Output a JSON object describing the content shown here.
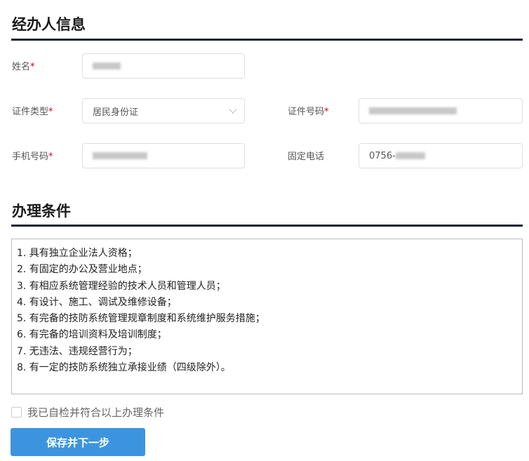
{
  "section1": {
    "title": "经办人信息"
  },
  "fields": {
    "name": {
      "label": "姓名",
      "required": "*"
    },
    "id_type": {
      "label": "证件类型",
      "required": "*",
      "value": "居民身份证"
    },
    "id_number": {
      "label": "证件号码",
      "required": "*"
    },
    "mobile": {
      "label": "手机号码",
      "required": "*"
    },
    "landline": {
      "label": "固定电话",
      "value_prefix": "0756-"
    }
  },
  "section2": {
    "title": "办理条件"
  },
  "conditions": [
    "1. 具有独立企业法人资格；",
    "2. 有固定的办公及营业地点；",
    "3. 有相应系统管理经验的技术人员和管理人员；",
    "4. 有设计、施工、调试及维修设备；",
    "5. 有完备的技防系统管理规章制度和系统维护服务措施；",
    "6. 有完备的培训资料及培训制度；",
    "7. 无违法、违规经营行为；",
    "8. 有一定的技防系统独立承接业绩（四级除外）。"
  ],
  "agree": {
    "label": "我已自检并符合以上办理条件"
  },
  "submit": {
    "label": "保存并下一步"
  }
}
